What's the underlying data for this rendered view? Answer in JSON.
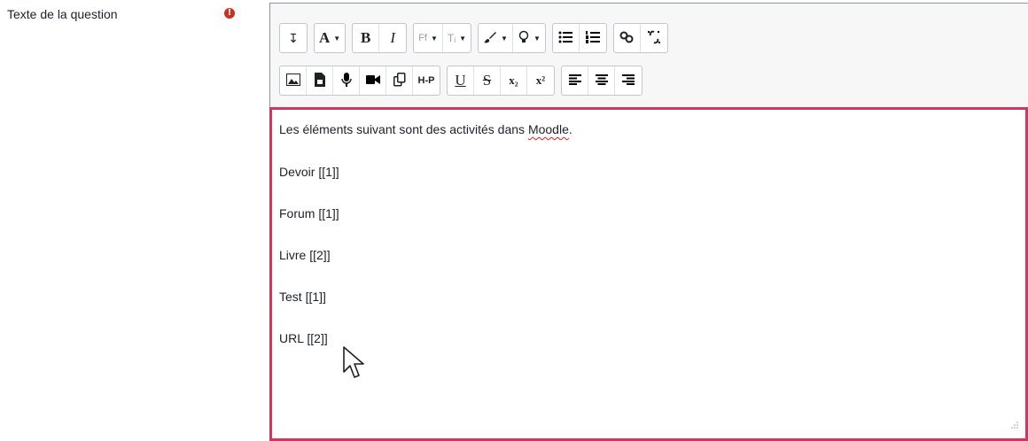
{
  "field": {
    "label": "Texte de la question",
    "required_icon": "!"
  },
  "toolbar": {
    "row1": [
      {
        "name": "show-more-buttons-button",
        "icon": "arrow-down-icon",
        "text": "↧"
      },
      {
        "name": "font-style-button",
        "icon": "font-icon",
        "text": "A"
      },
      {
        "name": "bold-button",
        "icon": "bold-icon",
        "text": "B"
      },
      {
        "name": "italic-button",
        "icon": "italic-icon",
        "text": "I"
      },
      {
        "name": "font-family-button",
        "icon": "font-family-icon",
        "text": "Ff"
      },
      {
        "name": "font-size-button",
        "icon": "font-size-icon",
        "text": "Tᵢ"
      },
      {
        "name": "font-color-button",
        "icon": "brush-icon",
        "text": "🖌"
      },
      {
        "name": "background-color-button",
        "icon": "highlight-icon",
        "text": "ஓ"
      },
      {
        "name": "unordered-list-button",
        "icon": "bullet-list-icon",
        "text": "☰"
      },
      {
        "name": "ordered-list-button",
        "icon": "numbered-list-icon",
        "text": "⁝☰"
      },
      {
        "name": "link-button",
        "icon": "link-icon",
        "text": "∞"
      },
      {
        "name": "unlink-button",
        "icon": "unlink-icon",
        "text": "⛓"
      }
    ],
    "row2": [
      {
        "name": "image-button",
        "icon": "image-icon",
        "text": "▣"
      },
      {
        "name": "media-button",
        "icon": "file-icon",
        "text": "🗎"
      },
      {
        "name": "record-audio-button",
        "icon": "microphone-icon",
        "text": "🎙"
      },
      {
        "name": "record-video-button",
        "icon": "video-camera-icon",
        "text": "■◀"
      },
      {
        "name": "manage-files-button",
        "icon": "copy-icon",
        "text": "⧉"
      },
      {
        "name": "h5p-button",
        "icon": "h5p-icon",
        "text": "H-P"
      },
      {
        "name": "underline-button",
        "icon": "underline-icon",
        "text": "U"
      },
      {
        "name": "strikethrough-button",
        "icon": "strikethrough-icon",
        "text": "S"
      },
      {
        "name": "subscript-button",
        "icon": "subscript-icon",
        "text": "x₂"
      },
      {
        "name": "superscript-button",
        "icon": "superscript-icon",
        "text": "x²"
      },
      {
        "name": "align-left-button",
        "icon": "align-left-icon",
        "text": "≡"
      },
      {
        "name": "align-center-button",
        "icon": "align-center-icon",
        "text": "≡"
      },
      {
        "name": "align-right-button",
        "icon": "align-right-icon",
        "text": "≡"
      }
    ]
  },
  "content": {
    "intro_before": "Les éléments suivant sont des activités dans ",
    "intro_word": "Moodle",
    "intro_after": ".",
    "lines": [
      "Devoir [[1]]",
      "Forum [[1]]",
      "Livre [[2]]",
      "Test [[1]]",
      "URL [[2]]"
    ]
  },
  "colors": {
    "focus_border": "#d1365f",
    "required": "#ca3120",
    "spellcheck": "#e02020"
  }
}
